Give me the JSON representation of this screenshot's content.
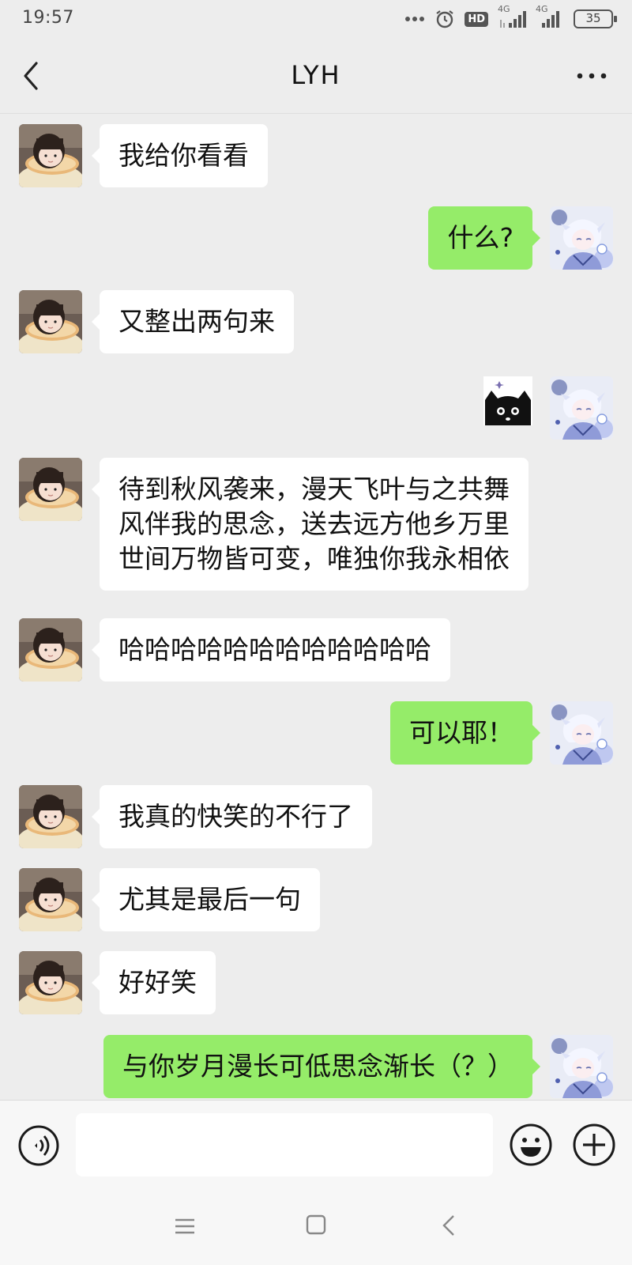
{
  "status_bar": {
    "time": "19:57",
    "hd_label": "HD",
    "network_1": "4G",
    "network_2": "4G",
    "battery": "35"
  },
  "header": {
    "title": "LYH"
  },
  "messages": [
    {
      "side": "left",
      "text": "我给你看看"
    },
    {
      "side": "right",
      "text": "什么?"
    },
    {
      "side": "left",
      "text": "又整出两句来"
    },
    {
      "side": "right",
      "type": "sticker",
      "icon": "black-cat-sticker"
    },
    {
      "side": "left",
      "lines": [
        "待到秋风袭来，漫天飞叶与之共舞",
        "风伴我的思念，送去远方他乡万里",
        "世间万物皆可变，唯独你我永相依"
      ]
    },
    {
      "side": "left",
      "text": "哈哈哈哈哈哈哈哈哈哈哈哈"
    },
    {
      "side": "right",
      "text": "可以耶！"
    },
    {
      "side": "left",
      "text": "我真的快笑的不行了"
    },
    {
      "side": "left",
      "text": "尤其是最后一句"
    },
    {
      "side": "left",
      "text": "好好笑"
    },
    {
      "side": "right",
      "text": "与你岁月漫长可低思念渐长（？）"
    }
  ],
  "input_bar": {
    "placeholder": "",
    "voice_icon": "voice-icon",
    "emoji_icon": "emoji-icon",
    "plus_icon": "plus-icon"
  },
  "colors": {
    "background": "#ededed",
    "sent_bubble": "#95ec69",
    "received_bubble": "#ffffff"
  }
}
